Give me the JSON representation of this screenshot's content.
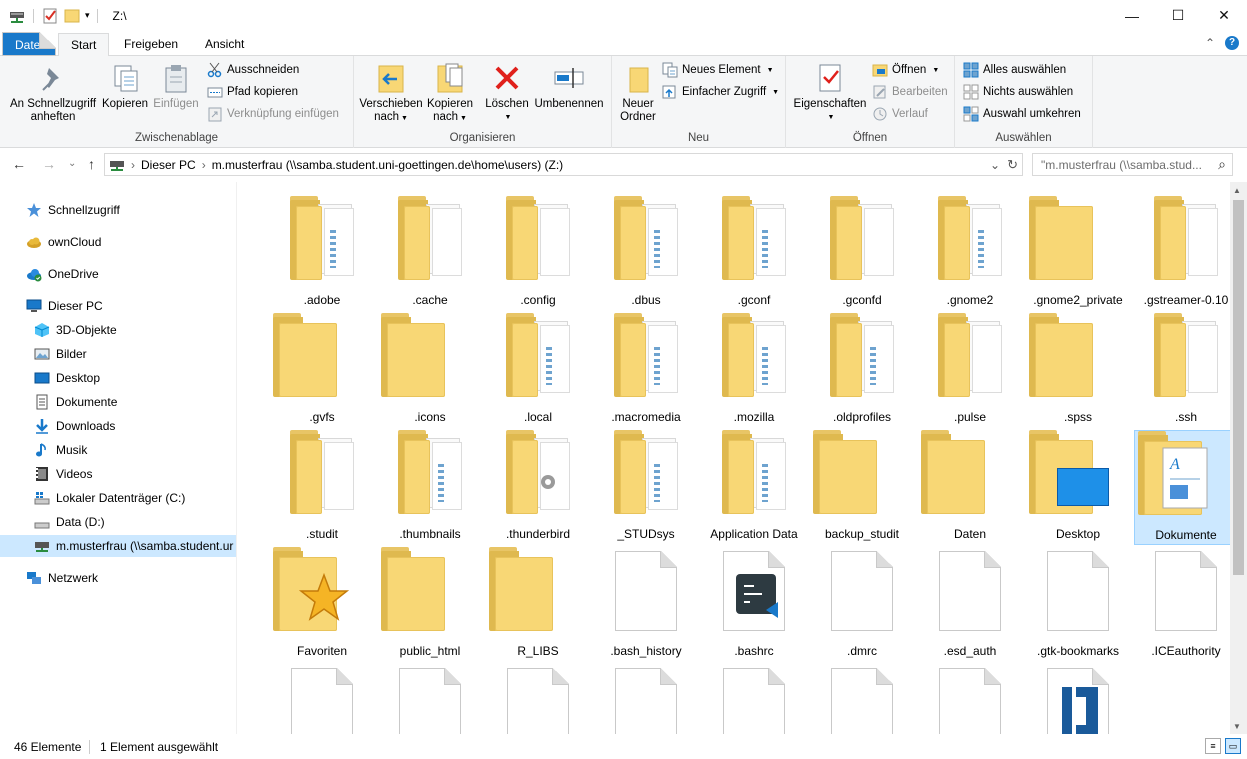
{
  "window": {
    "title": "Z:\\",
    "minimize": "—",
    "maximize": "☐",
    "close": "✕"
  },
  "tabs": {
    "file": "Datei",
    "start": "Start",
    "share": "Freigeben",
    "view": "Ansicht",
    "collapse": "⌃",
    "help": "?"
  },
  "ribbon": {
    "clipboard": {
      "label": "Zwischenablage",
      "pin": "An Schnellzugriff anheften",
      "copy": "Kopieren",
      "paste": "Einfügen",
      "cut": "Ausschneiden",
      "copy_path": "Pfad kopieren",
      "paste_shortcut": "Verknüpfung einfügen"
    },
    "organize": {
      "label": "Organisieren",
      "move": "Verschieben nach",
      "copy_to": "Kopieren nach",
      "delete": "Löschen",
      "rename": "Umbenennen"
    },
    "new": {
      "label": "Neu",
      "new_folder": "Neuer Ordner",
      "new_item": "Neues Element",
      "easy_access": "Einfacher Zugriff"
    },
    "open": {
      "label": "Öffnen",
      "properties": "Eigenschaften",
      "open": "Öffnen",
      "edit": "Bearbeiten",
      "history": "Verlauf"
    },
    "select": {
      "label": "Auswählen",
      "select_all": "Alles auswählen",
      "select_none": "Nichts auswählen",
      "invert": "Auswahl umkehren"
    }
  },
  "address": {
    "back": "←",
    "forward": "→",
    "recent": "⌄",
    "up": "↑",
    "path": [
      "Dieser PC",
      "m.musterfrau (\\\\samba.student.uni-goettingen.de\\home\\users) (Z:)"
    ],
    "sep": "›",
    "dropdown": "⌄",
    "refresh": "↻",
    "search_placeholder": "\"m.musterfrau (\\\\samba.stud...",
    "search_icon": "⌕"
  },
  "navpane": [
    {
      "label": "Schnellzugriff",
      "icon": "star-icon"
    },
    {
      "label": "ownCloud",
      "icon": "cloud-icon"
    },
    {
      "label": "OneDrive",
      "icon": "onedrive-icon"
    },
    {
      "label": "Dieser PC",
      "icon": "computer-icon"
    },
    {
      "label": "3D-Objekte",
      "icon": "cube-icon"
    },
    {
      "label": "Bilder",
      "icon": "pictures-icon"
    },
    {
      "label": "Desktop",
      "icon": "desktop-icon"
    },
    {
      "label": "Dokumente",
      "icon": "document-icon"
    },
    {
      "label": "Downloads",
      "icon": "download-icon"
    },
    {
      "label": "Musik",
      "icon": "music-icon"
    },
    {
      "label": "Videos",
      "icon": "video-icon"
    },
    {
      "label": "Lokaler Datenträger (C:)",
      "icon": "drive-icon"
    },
    {
      "label": "Data (D:)",
      "icon": "drive-icon"
    },
    {
      "label": "m.musterfrau (\\\\samba.student.ur",
      "icon": "network-drive-icon"
    },
    {
      "label": "Netzwerk",
      "icon": "network-icon"
    }
  ],
  "items": [
    {
      "label": ".adobe",
      "kind": "folder-docs"
    },
    {
      "label": ".cache",
      "kind": "folder-paper"
    },
    {
      "label": ".config",
      "kind": "folder-paper"
    },
    {
      "label": ".dbus",
      "kind": "folder-docs"
    },
    {
      "label": ".gconf",
      "kind": "folder-docs"
    },
    {
      "label": ".gconfd",
      "kind": "folder-paper"
    },
    {
      "label": ".gnome2",
      "kind": "folder-docs"
    },
    {
      "label": ".gnome2_private",
      "kind": "folder"
    },
    {
      "label": ".gstreamer-0.10",
      "kind": "folder-paper"
    },
    {
      "label": ".gvfs",
      "kind": "folder"
    },
    {
      "label": ".icons",
      "kind": "folder"
    },
    {
      "label": ".local",
      "kind": "folder-docs"
    },
    {
      "label": ".macromedia",
      "kind": "folder-docs"
    },
    {
      "label": ".mozilla",
      "kind": "folder-docs"
    },
    {
      "label": ".oldprofiles",
      "kind": "folder-docs"
    },
    {
      "label": ".pulse",
      "kind": "folder-paper"
    },
    {
      "label": ".spss",
      "kind": "folder"
    },
    {
      "label": ".ssh",
      "kind": "folder-paper"
    },
    {
      "label": ".studit",
      "kind": "folder-paper"
    },
    {
      "label": ".thumbnails",
      "kind": "folder-docs"
    },
    {
      "label": ".thunderbird",
      "kind": "folder-gear"
    },
    {
      "label": "_STUDsys",
      "kind": "folder-docs"
    },
    {
      "label": "Application Data",
      "kind": "folder-docs"
    },
    {
      "label": "backup_studit",
      "kind": "folder"
    },
    {
      "label": "Daten",
      "kind": "folder"
    },
    {
      "label": "Desktop",
      "kind": "folder-desktop"
    },
    {
      "label": "Dokumente",
      "kind": "folder-document",
      "selected": true
    },
    {
      "label": "Favoriten",
      "kind": "folder-star"
    },
    {
      "label": "public_html",
      "kind": "folder"
    },
    {
      "label": "R_LIBS",
      "kind": "folder"
    },
    {
      "label": ".bash_history",
      "kind": "file"
    },
    {
      "label": ".bashrc",
      "kind": "file-vscode"
    },
    {
      "label": ".dmrc",
      "kind": "file"
    },
    {
      "label": ".esd_auth",
      "kind": "file"
    },
    {
      "label": ".gtk-bookmarks",
      "kind": "file"
    },
    {
      "label": ".ICEauthority",
      "kind": "file"
    },
    {
      "label": "",
      "kind": "file"
    },
    {
      "label": "",
      "kind": "file"
    },
    {
      "label": "",
      "kind": "file"
    },
    {
      "label": "",
      "kind": "file"
    },
    {
      "label": "",
      "kind": "file"
    },
    {
      "label": "",
      "kind": "file"
    },
    {
      "label": "",
      "kind": "file"
    },
    {
      "label": "",
      "kind": "file-cd"
    }
  ],
  "status": {
    "count": "46 Elemente",
    "selected": "1 Element ausgewählt"
  },
  "colors": {
    "accent": "#1979ca",
    "selection": "#cce8ff",
    "folder": "#f8d775"
  }
}
